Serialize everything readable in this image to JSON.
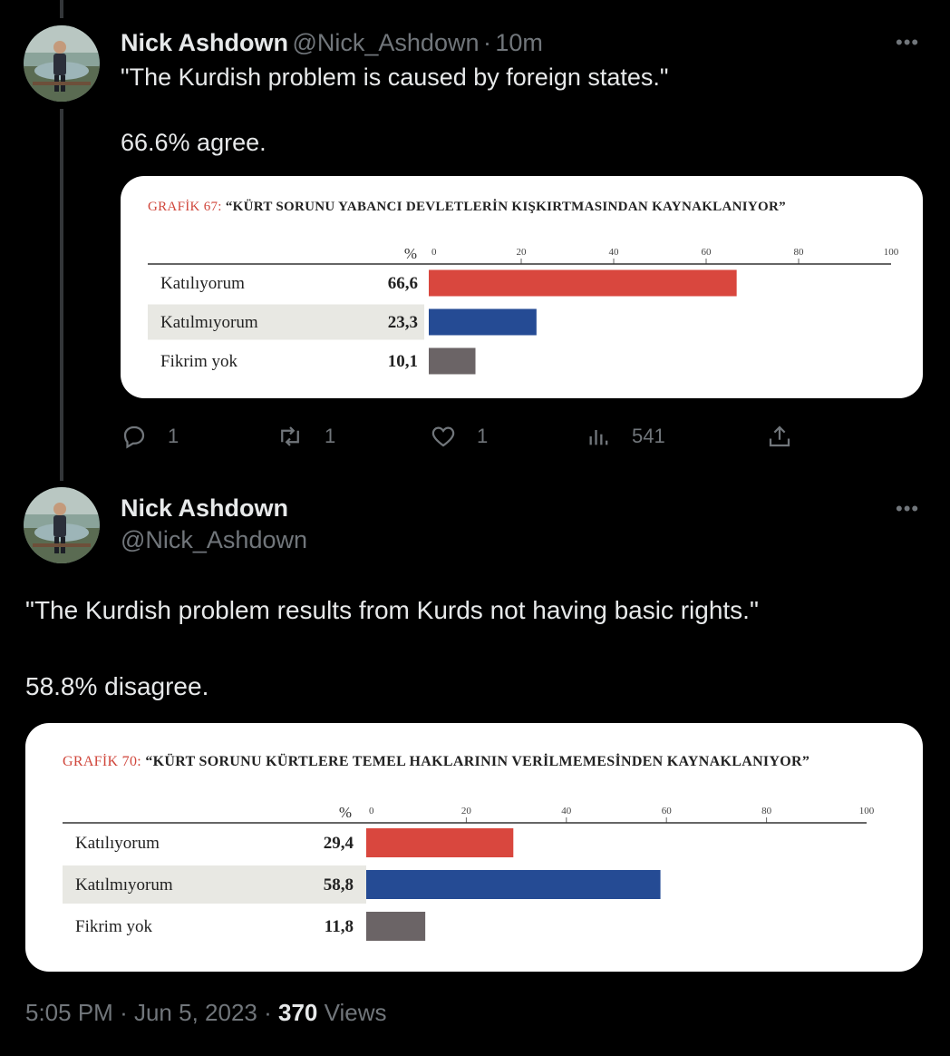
{
  "tweet1": {
    "name": "Nick Ashdown",
    "handle": "@Nick_Ashdown",
    "time": "10m",
    "text": "\"The Kurdish problem is caused by foreign states.\"\n\n66.6% agree.",
    "actions": {
      "replies": "1",
      "retweets": "1",
      "likes": "1",
      "views": "541"
    }
  },
  "tweet2": {
    "name": "Nick Ashdown",
    "handle": "@Nick_Ashdown",
    "text": "\"The Kurdish problem results from Kurds not having basic rights.\"\n\n58.8% disagree.",
    "footer": {
      "time": "5:05 PM",
      "date": "Jun 5, 2023",
      "views_count": "370",
      "views_label": "Views"
    }
  },
  "chart_data": [
    {
      "type": "bar",
      "title_prefix": "GRAFİK 67:",
      "title": "“KÜRT SORUNU YABANCI DEVLETLERİN KIŞKIRTMASINDAN KAYNAKLANIYOR”",
      "unit": "%",
      "categories": [
        "Katılıyorum",
        "Katılmıyorum",
        "Fikrim yok"
      ],
      "values": [
        66.6,
        23.3,
        10.1
      ],
      "value_labels": [
        "66,6",
        "23,3",
        "10,1"
      ],
      "colors": [
        "#d9473e",
        "#254b94",
        "#6b6466"
      ],
      "xlim": [
        0,
        100
      ],
      "ticks": [
        0,
        20,
        40,
        60,
        80,
        100
      ]
    },
    {
      "type": "bar",
      "title_prefix": "GRAFİK 70:",
      "title": "“KÜRT SORUNU KÜRTLERE TEMEL HAKLARININ VERİLMEMESİNDEN KAYNAKLANIYOR”",
      "unit": "%",
      "categories": [
        "Katılıyorum",
        "Katılmıyorum",
        "Fikrim yok"
      ],
      "values": [
        29.4,
        58.8,
        11.8
      ],
      "value_labels": [
        "29,4",
        "58,8",
        "11,8"
      ],
      "colors": [
        "#d9473e",
        "#254b94",
        "#6b6466"
      ],
      "xlim": [
        0,
        100
      ],
      "ticks": [
        0,
        20,
        40,
        60,
        80,
        100
      ]
    }
  ]
}
